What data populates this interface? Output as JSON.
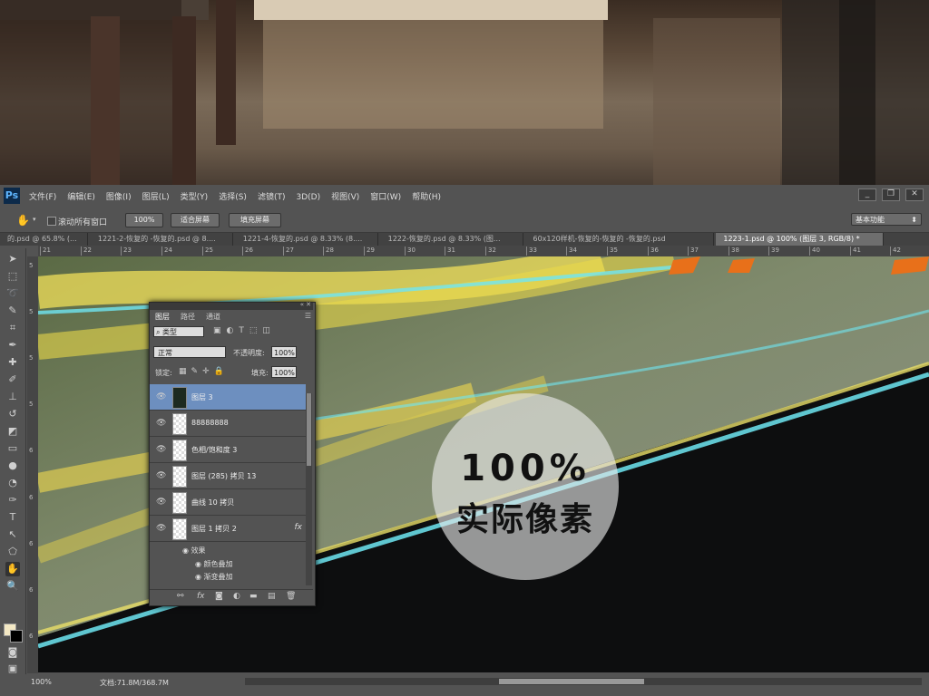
{
  "menu": [
    "文件(F)",
    "编辑(E)",
    "图像(I)",
    "图层(L)",
    "类型(Y)",
    "选择(S)",
    "滤镜(T)",
    "3D(D)",
    "视图(V)",
    "窗口(W)",
    "帮助(H)"
  ],
  "app_logo": "Ps",
  "window_controls": [
    "_",
    "❐",
    "✕"
  ],
  "options_bar": {
    "scroll_all_label": "滚动所有窗口",
    "zoom_value": "100%",
    "fit_screen": "适合屏幕",
    "fill_screen": "填充屏幕",
    "workspace": "基本功能"
  },
  "doc_tabs": [
    {
      "label": "的.psd @ 65.8% (...",
      "active": false
    },
    {
      "label": "1221-2-恢复的 -恢复的.psd @ 8....",
      "active": false
    },
    {
      "label": "1221-4-恢复的.psd @ 8.33% (8....",
      "active": false
    },
    {
      "label": "1222-恢复的.psd @ 8.33% (图...",
      "active": false
    },
    {
      "label": "60x120样机-恢复的-恢复的 -恢复的.psd",
      "active": false
    },
    {
      "label": "1223-1.psd @ 100% (图层 3, RGB/8) *",
      "active": true
    }
  ],
  "ruler_top_numbers": [
    "21",
    "22",
    "23",
    "24",
    "25",
    "26",
    "27",
    "28",
    "29",
    "30",
    "31",
    "32",
    "33",
    "34",
    "35",
    "36",
    "37",
    "38",
    "39",
    "40",
    "41",
    "42"
  ],
  "ruler_left_numbers": [
    "5",
    "5",
    "5",
    "5",
    "6",
    "6",
    "6",
    "6",
    "6"
  ],
  "layers_panel": {
    "tabs": [
      "图层",
      "路径",
      "通道"
    ],
    "kind_filter": "类型",
    "blend_mode": "正常",
    "opacity_label": "不透明度:",
    "opacity_value": "100%",
    "lock_label": "锁定:",
    "fill_label": "填充:",
    "fill_value": "100%",
    "layers": [
      {
        "name": "图层 3",
        "selected": true,
        "fx": ""
      },
      {
        "name": "88888888",
        "selected": false,
        "fx": ""
      },
      {
        "name": "色相/饱和度 3",
        "selected": false,
        "fx": ""
      },
      {
        "name": "图层 (285) 拷贝 13",
        "selected": false,
        "fx": ""
      },
      {
        "name": "曲线 10 拷贝",
        "selected": false,
        "fx": ""
      },
      {
        "name": "图层 1 拷贝 2",
        "selected": false,
        "fx": "fx"
      }
    ],
    "effects_header": "效果",
    "effects": [
      "颜色叠加",
      "渐变叠加"
    ],
    "bottom_icons": [
      "link-icon",
      "fx-icon",
      "mask-icon",
      "adjustment-icon",
      "folder-icon",
      "new-layer-icon",
      "trash-icon"
    ]
  },
  "overlay": {
    "line1": "100%",
    "line2": "实际像素"
  },
  "status_bar": {
    "zoom": "100%",
    "doc_size": "文档:71.8M/368.7M"
  },
  "colors": {
    "foreground": "#f3e8c4",
    "background": "#000000",
    "accent_orange": "#e8701a"
  }
}
